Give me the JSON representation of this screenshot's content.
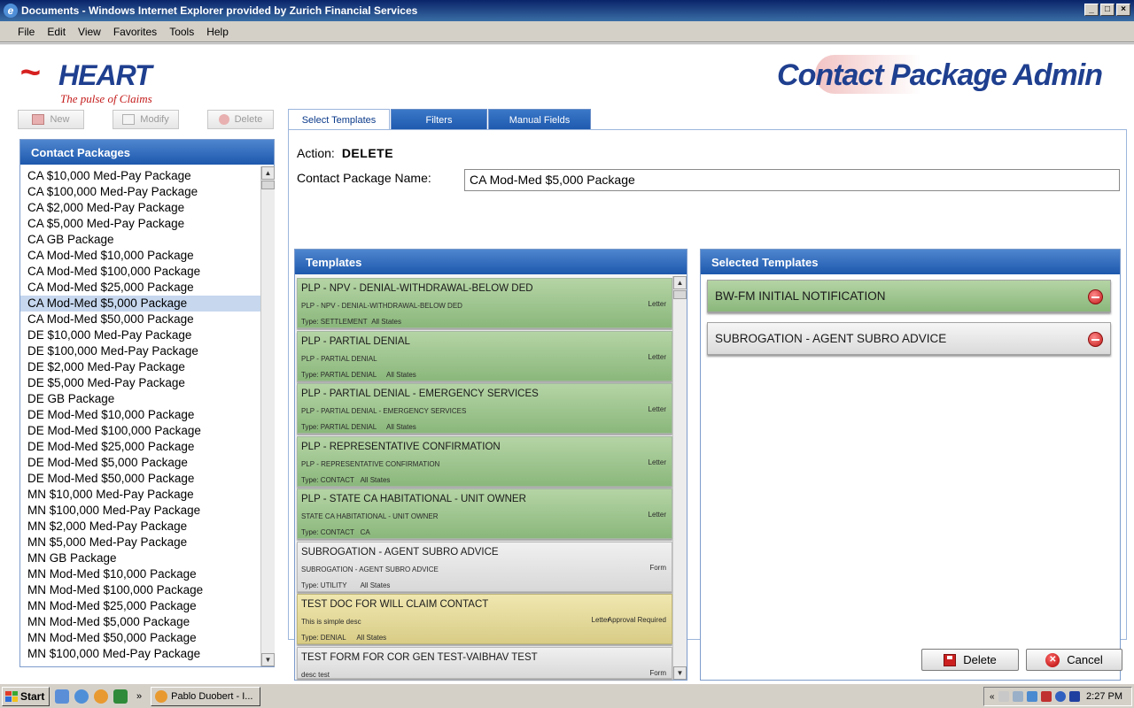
{
  "window": {
    "title": "Documents - Windows Internet Explorer provided by Zurich Financial Services"
  },
  "menu": [
    "File",
    "Edit",
    "View",
    "Favorites",
    "Tools",
    "Help"
  ],
  "logo": {
    "brand": "HEART",
    "tagline": "The pulse of Claims"
  },
  "app_title": "Contact Package Admin",
  "toolbar": {
    "new_label": "New",
    "modify_label": "Modify",
    "delete_label": "Delete"
  },
  "packages": {
    "header": "Contact Packages",
    "selected_index": 8,
    "items": [
      "CA $10,000 Med-Pay Package",
      "CA $100,000 Med-Pay Package",
      "CA $2,000 Med-Pay Package",
      "CA $5,000 Med-Pay Package",
      "CA GB Package",
      "CA Mod-Med $10,000 Package",
      "CA Mod-Med $100,000 Package",
      "CA Mod-Med $25,000 Package",
      "CA Mod-Med $5,000 Package",
      "CA Mod-Med $50,000 Package",
      "DE $10,000 Med-Pay Package",
      "DE $100,000 Med-Pay Package",
      "DE $2,000 Med-Pay Package",
      "DE $5,000 Med-Pay Package",
      "DE GB Package",
      "DE Mod-Med $10,000 Package",
      "DE Mod-Med $100,000 Package",
      "DE Mod-Med $25,000 Package",
      "DE Mod-Med $5,000 Package",
      "DE Mod-Med $50,000 Package",
      "MN $10,000 Med-Pay Package",
      "MN $100,000 Med-Pay Package",
      "MN $2,000 Med-Pay Package",
      "MN $5,000 Med-Pay Package",
      "MN GB Package",
      "MN Mod-Med $10,000 Package",
      "MN Mod-Med $100,000 Package",
      "MN Mod-Med $25,000 Package",
      "MN Mod-Med $5,000 Package",
      "MN Mod-Med $50,000 Package",
      "MN $100,000 Med-Pay Package"
    ]
  },
  "tabs": [
    {
      "label": "Select Templates",
      "active": true
    },
    {
      "label": "Filters",
      "active": false
    },
    {
      "label": "Manual Fields",
      "active": false
    }
  ],
  "action": {
    "label": "Action:",
    "value": "DELETE"
  },
  "package_name": {
    "label": "Contact Package Name:",
    "value": "CA Mod-Med $5,000 Package"
  },
  "templates": {
    "header": "Templates",
    "items": [
      {
        "title": "PLP - NPV - DENIAL-WITHDRAWAL-BELOW DED",
        "desc": "PLP - NPV - DENIAL-WITHDRAWAL-BELOW DED",
        "doc_type": "Letter",
        "approval": "",
        "type": "Type: SETTLEMENT",
        "states": "All States",
        "color": "green"
      },
      {
        "title": "PLP - PARTIAL DENIAL",
        "desc": "PLP - PARTIAL DENIAL",
        "doc_type": "Letter",
        "approval": "",
        "type": "Type: PARTIAL DENIAL",
        "states": "All States",
        "color": "green"
      },
      {
        "title": "PLP - PARTIAL DENIAL - EMERGENCY SERVICES",
        "desc": "PLP - PARTIAL DENIAL - EMERGENCY SERVICES",
        "doc_type": "Letter",
        "approval": "",
        "type": "Type: PARTIAL DENIAL",
        "states": "All States",
        "color": "green"
      },
      {
        "title": "PLP - REPRESENTATIVE CONFIRMATION",
        "desc": "PLP - REPRESENTATIVE CONFIRMATION",
        "doc_type": "Letter",
        "approval": "",
        "type": "Type: CONTACT",
        "states": "All States",
        "color": "green"
      },
      {
        "title": "PLP - STATE CA HABITATIONAL - UNIT OWNER",
        "desc": "STATE CA HABITATIONAL - UNIT OWNER",
        "doc_type": "Letter",
        "approval": "",
        "type": "Type: CONTACT",
        "states": "CA",
        "color": "green"
      },
      {
        "title": "SUBROGATION - AGENT SUBRO ADVICE",
        "desc": "SUBROGATION - AGENT SUBRO ADVICE",
        "doc_type": "Form",
        "approval": "",
        "type": "Type: UTILITY",
        "states": "All States",
        "color": "gray"
      },
      {
        "title": "TEST DOC FOR WILL CLAIM CONTACT",
        "desc": "This is simple desc",
        "doc_type": "Letter",
        "approval": "Approval Required",
        "type": "Type: DENIAL",
        "states": "All States",
        "color": "yellow"
      },
      {
        "title": "TEST FORM FOR COR GEN TEST-VAIBHAV TEST",
        "desc": "desc test",
        "doc_type": "Form",
        "approval": "",
        "type": "",
        "states": "",
        "color": "gray"
      }
    ]
  },
  "selected_templates": {
    "header": "Selected Templates",
    "items": [
      {
        "title": "BW-FM INITIAL NOTIFICATION",
        "color": "green"
      },
      {
        "title": "SUBROGATION - AGENT SUBRO ADVICE",
        "color": "gray"
      }
    ]
  },
  "footer": {
    "delete_label": "Delete",
    "cancel_label": "Cancel"
  },
  "taskbar": {
    "start_label": "Start",
    "task_label": "Pablo Duobert - I...",
    "clock": "2:27 PM"
  },
  "colors": {
    "header_blue": "#1d58ad",
    "card_green": "#9cc28c",
    "card_yellow": "#e4d998",
    "card_gray": "#e0e0e0",
    "brand_red": "#d62020",
    "brand_blue": "#1f3f8f"
  }
}
